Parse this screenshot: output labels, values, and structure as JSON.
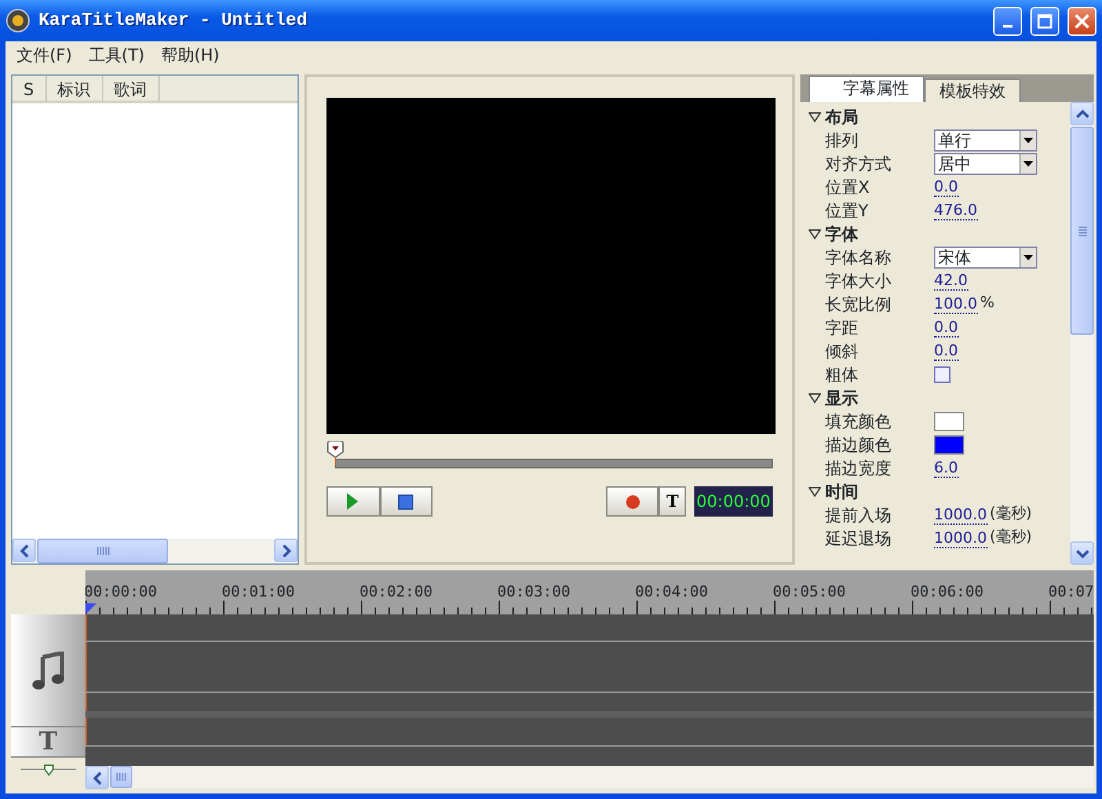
{
  "window": {
    "title": "KaraTitleMaker - Untitled"
  },
  "menu": [
    {
      "label": "文件(F)"
    },
    {
      "label": "工具(T)"
    },
    {
      "label": "帮助(H)"
    }
  ],
  "lyrics_list": {
    "columns": [
      "S",
      "标识",
      "歌词"
    ]
  },
  "player": {
    "seek": {
      "level": 0
    },
    "time": "00:00:00",
    "buttons": [
      {
        "kind": "play"
      },
      {
        "kind": "stop"
      },
      {
        "kind": "record"
      },
      {
        "kind": "text",
        "label": "T"
      }
    ]
  },
  "tabs": [
    {
      "label": "字幕属性",
      "selected": true
    },
    {
      "label": "模板特效",
      "selected": false
    }
  ],
  "properties": [
    {
      "label": "布局",
      "expanded": true,
      "children": [
        {
          "name": "排列",
          "kind": "dropdown",
          "value": "单行"
        },
        {
          "name": "对齐方式",
          "kind": "dropdown",
          "value": "居中"
        },
        {
          "name": "位置X",
          "kind": "value",
          "value": "0.0"
        },
        {
          "name": "位置Y",
          "kind": "value",
          "value": "476.0"
        }
      ]
    },
    {
      "label": "字体",
      "expanded": true,
      "children": [
        {
          "name": "字体名称",
          "kind": "dropdown",
          "value": "宋体"
        },
        {
          "name": "字体大小",
          "kind": "value",
          "value": "42.0"
        },
        {
          "name": "长宽比例",
          "kind": "value",
          "value": "100.0",
          "unit": "%"
        },
        {
          "name": "字距",
          "kind": "value",
          "value": "0.0"
        },
        {
          "name": "倾斜",
          "kind": "value",
          "value": "0.0"
        },
        {
          "name": "粗体",
          "kind": "checkbox",
          "checked": false
        }
      ]
    },
    {
      "label": "显示",
      "expanded": true,
      "children": [
        {
          "name": "填充颜色",
          "kind": "color",
          "color": "#ffffff"
        },
        {
          "name": "描边颜色",
          "kind": "color",
          "color": "#0000ff"
        },
        {
          "name": "描边宽度",
          "kind": "value",
          "value": "6.0"
        }
      ]
    },
    {
      "label": "时间",
      "expanded": true,
      "children": [
        {
          "name": "提前入场",
          "kind": "value",
          "value": "1000.0",
          "unit": "(毫秒)"
        },
        {
          "name": "延迟退场",
          "kind": "value",
          "value": "1000.0",
          "unit": "(毫秒)"
        }
      ]
    }
  ],
  "timeline": {
    "ruler": [
      "00:00:00",
      "00:01:00",
      "00:02:00",
      "00:03:00",
      "00:04:00",
      "00:05:00",
      "00:06:00",
      "00:07"
    ],
    "tracks": [
      {
        "kind": "audio"
      },
      {
        "kind": "text",
        "label": "T"
      }
    ],
    "zoom": {
      "level": 0.5
    }
  }
}
